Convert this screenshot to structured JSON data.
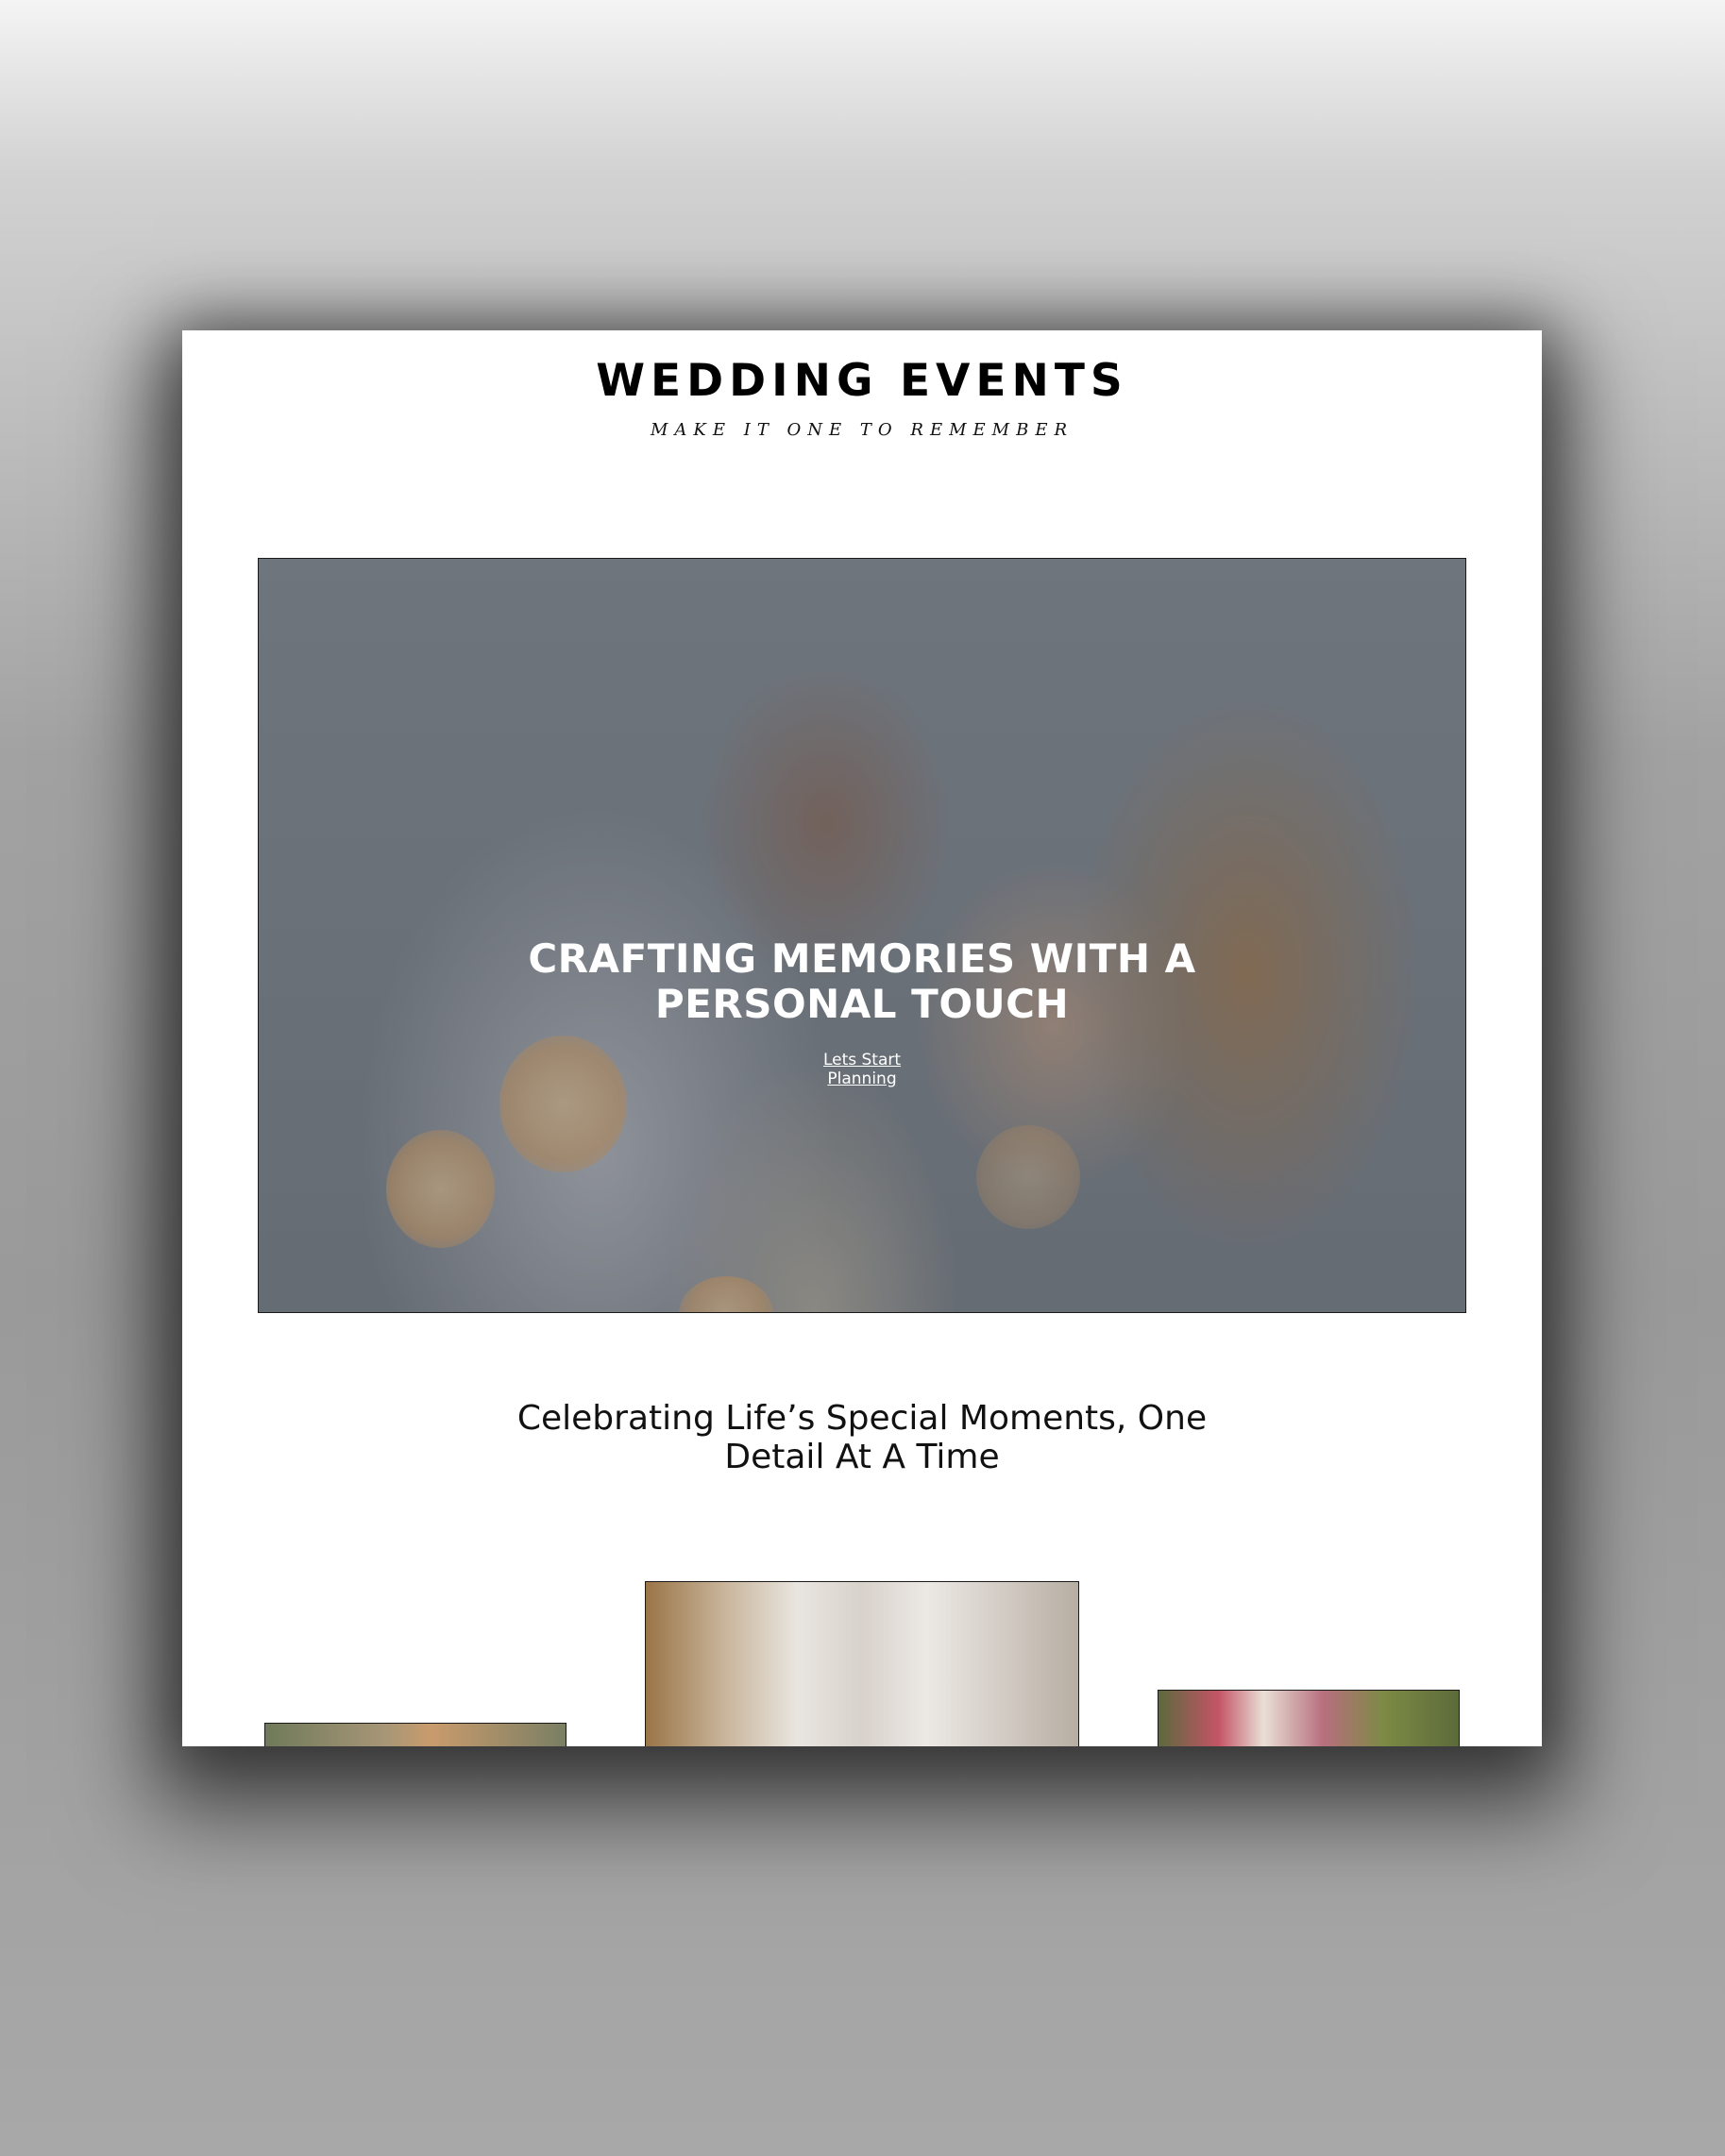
{
  "header": {
    "title": "WEDDING EVENTS",
    "tagline": "MAKE IT ONE TO REMEMBER"
  },
  "hero": {
    "headline": "CRAFTING MEMORIES WITH A PERSONAL TOUCH",
    "cta_label": "Lets Start Planning"
  },
  "intro": {
    "heading": "Celebrating Life’s Special Moments, One Detail At A Time"
  }
}
